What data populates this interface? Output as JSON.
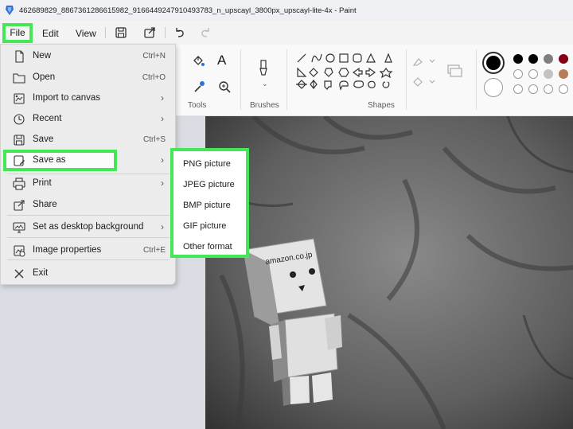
{
  "window": {
    "title": "462689829_8867361286615982_9166449247910493783_n_upscayl_3800px_upscayl-lite-4x - Paint"
  },
  "menubar": {
    "file": "File",
    "edit": "Edit",
    "view": "View"
  },
  "ribbon": {
    "tools_label": "Tools",
    "brushes_label": "Brushes",
    "shapes_label": "Shapes",
    "text_tool": "A"
  },
  "file_menu": {
    "items": [
      {
        "label": "New",
        "shortcut": "Ctrl+N",
        "icon": "new-file-icon"
      },
      {
        "label": "Open",
        "shortcut": "Ctrl+O",
        "icon": "folder-icon"
      },
      {
        "label": "Import to canvas",
        "submenu": true,
        "icon": "import-icon"
      },
      {
        "label": "Recent",
        "submenu": true,
        "icon": "clock-icon"
      },
      {
        "label": "Save",
        "shortcut": "Ctrl+S",
        "icon": "save-icon"
      },
      {
        "label": "Save as",
        "submenu": true,
        "icon": "save-as-icon"
      },
      {
        "label": "Print",
        "submenu": true,
        "icon": "print-icon"
      },
      {
        "label": "Share",
        "icon": "share-icon"
      },
      {
        "label": "Set as desktop background",
        "submenu": true,
        "icon": "desktop-icon"
      },
      {
        "label": "Image properties",
        "shortcut": "Ctrl+E",
        "icon": "properties-icon"
      },
      {
        "label": "Exit",
        "icon": "close-icon"
      }
    ]
  },
  "save_as_submenu": {
    "items": [
      "PNG picture",
      "JPEG picture",
      "BMP picture",
      "GIF picture",
      "Other format"
    ]
  },
  "photo": {
    "box_text": "amazon.co.jp"
  },
  "colors": {
    "highlight": "#44e857",
    "palette_row1": [
      "#000000",
      "#000000",
      "#7f7f7f",
      "#880015",
      "#ed1c24"
    ],
    "palette_row2": [
      "#ffffff",
      "#ffffff",
      "#c3c3c3",
      "#b97a57",
      "#ffaec9"
    ]
  }
}
